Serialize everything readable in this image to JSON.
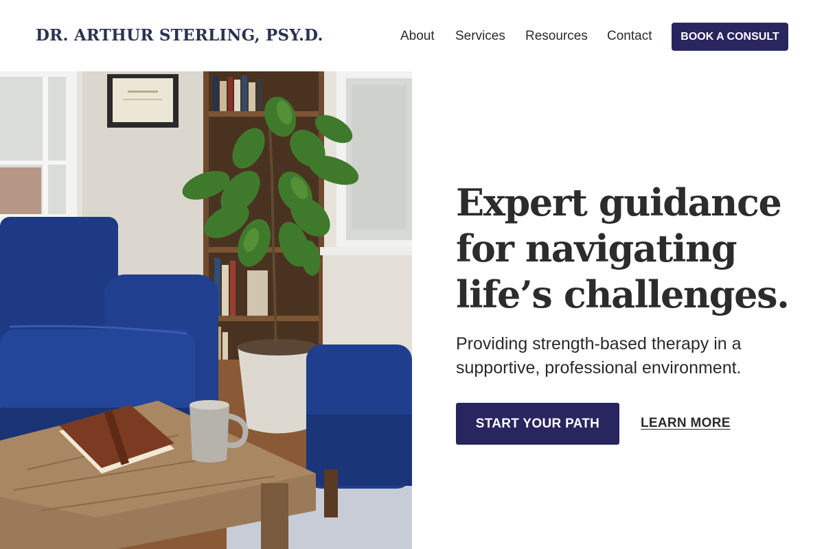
{
  "header": {
    "brand": "DR. ARTHUR STERLING, PSY.D.",
    "nav": [
      {
        "label": "About"
      },
      {
        "label": "Services"
      },
      {
        "label": "Resources"
      },
      {
        "label": "Contact"
      }
    ],
    "cta_label": "BOOK A CONSULT"
  },
  "hero": {
    "headline": "Expert guidance for navigating life’s challenges.",
    "subtext": "Providing strength-based therapy in a supportive, professional environment.",
    "primary_button": "START YOUR PATH",
    "secondary_link": "LEARN MORE",
    "image_subject": "therapy office with blue armchairs, fiddle leaf fig plant, bookshelf, wooden coffee table, leather journal and mug"
  },
  "colors": {
    "accent": "#28255f",
    "brand_text": "#2b3350",
    "headline_text": "#2c2c2c",
    "chair_blue": "#1f3f8a"
  }
}
